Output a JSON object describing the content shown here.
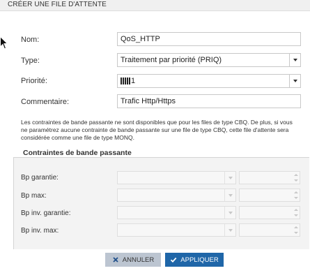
{
  "window": {
    "title": "CRÉER UNE FILE D'ATTENTE"
  },
  "form": {
    "name": {
      "label": "Nom:",
      "value": "QoS_HTTP"
    },
    "type": {
      "label": "Type:",
      "value": "Traitement par priorité (PRIQ)"
    },
    "priority": {
      "label": "Priorité:",
      "value": "1"
    },
    "comment": {
      "label": "Commentaire:",
      "value": "Trafic Http/Https"
    }
  },
  "note": "Les contraintes de bande passante ne sont disponibles que pour les files de type CBQ. De plus, si vous ne paramétrez aucune contrainte de bande passante sur une file de type CBQ, cette file d'attente sera considérée comme une file de type MONQ.",
  "bandwidth": {
    "title": "Contraintes de bande passante",
    "rows": [
      {
        "label": "Bp garantie:"
      },
      {
        "label": "Bp max:"
      },
      {
        "label": "Bp inv. garantie:"
      },
      {
        "label": "Bp inv. max:"
      }
    ]
  },
  "buttons": {
    "cancel": "ANNULER",
    "apply": "APPLIQUER"
  },
  "icons": {
    "cancel": "close-icon",
    "apply": "check-icon",
    "cursor": "mouse-pointer-icon"
  },
  "colors": {
    "apply_bg": "#1f66a8",
    "cancel_bg": "#bcc5d1"
  }
}
